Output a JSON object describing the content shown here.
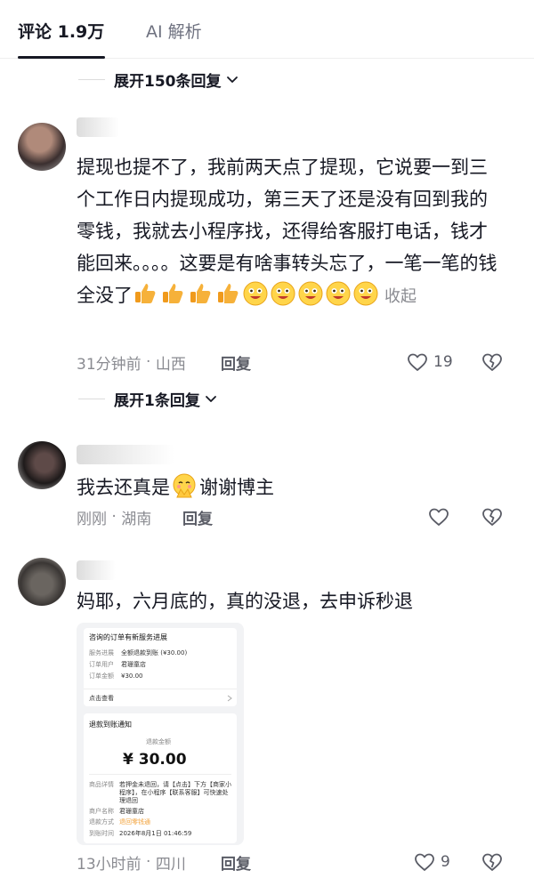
{
  "tabs": {
    "comments": "评论 1.9万",
    "ai": "AI 解析"
  },
  "expand1": "展开150条回复",
  "expand2": "展开1条回复",
  "comments": [
    {
      "text": "提现也提不了，我前两天点了提现，它说要一到三个工作日内提现成功，第三天了还是没有回到我的零钱，我就去小程序找，还得给客服打电话，钱才能回来。。。。这要是有啥事转头忘了，一笔一笔的钱全没了",
      "collapse": "收起",
      "time": "31分钟前",
      "location": "山西",
      "reply": "回复",
      "likes": "19"
    },
    {
      "text_before": "我去还真是",
      "text_after": "谢谢博主",
      "time": "刚刚",
      "location": "湖南",
      "reply": "回复"
    },
    {
      "text": "妈耶，六月底的，真的没退，去申诉秒退",
      "time": "13小时前",
      "location": "四川",
      "reply": "回复",
      "likes": "9"
    }
  ],
  "screenshot": {
    "title": "咨询的订单有新服务进展",
    "rows": [
      {
        "k": "服务进展",
        "v": "全额退款到账 (¥30.00)"
      },
      {
        "k": "订单用户",
        "v": "君珊童店"
      },
      {
        "k": "订单金额",
        "v": "¥30.00"
      }
    ],
    "link": "点击查看",
    "notice_title": "退款到账通知",
    "refund_label": "退款金额",
    "amount": "¥ 30.00",
    "detail_k": "商品详情",
    "detail_v": "若押金未退回，请【点击】下方【商家小程序】，在小程序【联系客服】可快速处理退回",
    "merchant_k": "商户名称",
    "merchant_v": "君珊童店",
    "method_k": "退款方式",
    "method_v": "退回零钱通",
    "time_k": "到账时间",
    "time_v": "2026年8月1日 01:46:59"
  },
  "colors": {
    "text": "#161823",
    "muted": "#8a8b91",
    "thumb": "#f6a623",
    "accent_like": "#5a5c66"
  }
}
